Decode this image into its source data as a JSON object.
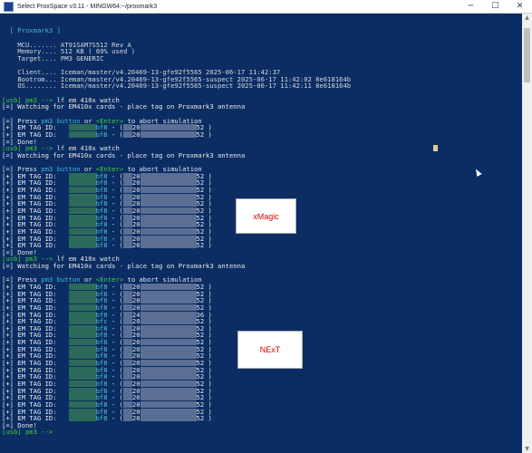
{
  "window": {
    "title": "Select ProxSpace v3.11 - MINGW64:~/proxmark3",
    "minimize": "─",
    "maximize": "☐",
    "close": "✕"
  },
  "header": {
    "brand": "[ Proxmark3 ]",
    "mcu": "MCU....... AT91SAM7S512 Rev A",
    "memory": "Memory.... 512 KB ( 69% used )",
    "target": "Target.... PM3 GENERIC",
    "client": "Client.... Iceman/master/v4.20469-13-gfe92f5565 2025-06-17 11:42:37",
    "bootrom": "Bootrom... Iceman/master/v4.20469-13-gfe92f5565-suspect 2025-06-17 11:42:02 8e618164b",
    "os": "OS........ Iceman/master/v4.20469-13-gfe92f5565-suspect 2025-06-17 11:42:11 8e618164b"
  },
  "terminal": {
    "prompt": "[usb] pm3 -->",
    "command": " lf em 410x watch",
    "watching": "[=] Watching for EM410x cards - place tag on Proxmark3 antenna",
    "abort_prefix": "[=] Press ",
    "abort_pm3": "pm3 button",
    "abort_or": " or ",
    "abort_enter": "<Enter>",
    "abort_suffix": " to abort simulation",
    "tag_prefix": "[+] EM TAG ID:",
    "bf": "bf8 - (",
    "id_start": "20",
    "done": "[=] Done!",
    "block1_ids": [
      "52",
      "52"
    ],
    "block2_ids": [
      "52",
      "52",
      "52",
      "52",
      "52",
      "52",
      "52",
      "52",
      "52",
      "52",
      "52"
    ],
    "block3_ids": [
      {
        "bf": "bf8",
        "start": "20",
        "end": "52"
      },
      {
        "bf": "bf8",
        "start": "20",
        "end": "52"
      },
      {
        "bf": "bf8",
        "start": "20",
        "end": "52"
      },
      {
        "bf": "bf8",
        "start": "20",
        "end": "52"
      },
      {
        "bf": "bf8",
        "start": "24",
        "end": "36"
      },
      {
        "bf": "bfc",
        "start": "20",
        "end": "52"
      },
      {
        "bf": "bf8",
        "start": "20",
        "end": "52"
      },
      {
        "bf": "bf8",
        "start": "20",
        "end": "52"
      },
      {
        "bf": "bf8",
        "start": "20",
        "end": "52"
      },
      {
        "bf": "bf8",
        "start": "20",
        "end": "52"
      },
      {
        "bf": "bf8",
        "start": "20",
        "end": "52"
      },
      {
        "bf": "bf8",
        "start": "20",
        "end": "52"
      },
      {
        "bf": "bf8",
        "start": "20",
        "end": "52"
      },
      {
        "bf": "bf8",
        "start": "20",
        "end": "52"
      },
      {
        "bf": "bf8",
        "start": "20",
        "end": "52"
      },
      {
        "bf": "bf8",
        "start": "20",
        "end": "52"
      },
      {
        "bf": "bf8",
        "start": "20",
        "end": "52"
      },
      {
        "bf": "bf8",
        "start": "20",
        "end": "52"
      },
      {
        "bf": "bf8",
        "start": "20",
        "end": "52"
      },
      {
        "bf": "bf8",
        "start": "20",
        "end": "52"
      }
    ],
    "final_prompt": "[usb] pm3 -->",
    "close_paren": " )"
  },
  "labels": {
    "xmagic": "xMagic",
    "next": "NExT"
  },
  "colors": {
    "background": "#0b2d63",
    "label_text": "#e00000"
  }
}
